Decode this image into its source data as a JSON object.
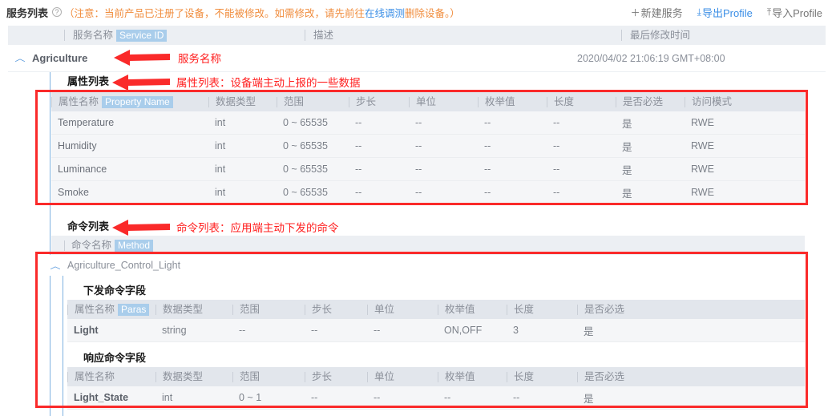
{
  "header": {
    "title": "服务列表",
    "help_icon": "help-circle-icon",
    "notice_prefix": "（注意：当前产品已注册了设备，不能被修改。如需修改，请先前往",
    "notice_link": "在线调测",
    "notice_suffix": "删除设备。）",
    "actions": [
      {
        "icon": "plus-icon",
        "glyph": "＋",
        "label": "新建服务",
        "style": "grey"
      },
      {
        "icon": "download-icon",
        "glyph": "⤓",
        "label": "导出Profile",
        "style": "blue"
      },
      {
        "icon": "upload-icon",
        "glyph": "⤒",
        "label": "导入Profile",
        "style": "grey"
      }
    ]
  },
  "service_table": {
    "columns": [
      {
        "label": "服务名称",
        "highlight": "Service ID"
      },
      {
        "label": "描述",
        "highlight": ""
      },
      {
        "label": "最后修改时间",
        "highlight": ""
      }
    ],
    "row": {
      "expander": "collapse-caret-icon",
      "name": "Agriculture",
      "description": "",
      "last_modified": "2020/04/02 21:06:19 GMT+08:00"
    }
  },
  "property_section": {
    "title": "属性列表",
    "annotation": "属性列表：设备端主动上报的一些数据",
    "arrow": "left-arrow-icon",
    "columns": [
      {
        "label": "属性名称",
        "highlight": "Property Name"
      },
      {
        "label": "数据类型",
        "highlight": ""
      },
      {
        "label": "范围",
        "highlight": ""
      },
      {
        "label": "步长",
        "highlight": ""
      },
      {
        "label": "单位",
        "highlight": ""
      },
      {
        "label": "枚举值",
        "highlight": ""
      },
      {
        "label": "长度",
        "highlight": ""
      },
      {
        "label": "是否必选",
        "highlight": ""
      },
      {
        "label": "访问模式",
        "highlight": ""
      }
    ],
    "rows": [
      {
        "name": "Temperature",
        "type": "int",
        "range": "0 ~ 65535",
        "step": "--",
        "unit": "--",
        "enum": "--",
        "length": "--",
        "required": "是",
        "access": "RWE"
      },
      {
        "name": "Humidity",
        "type": "int",
        "range": "0 ~ 65535",
        "step": "--",
        "unit": "--",
        "enum": "--",
        "length": "--",
        "required": "是",
        "access": "RWE"
      },
      {
        "name": "Luminance",
        "type": "int",
        "range": "0 ~ 65535",
        "step": "--",
        "unit": "--",
        "enum": "--",
        "length": "--",
        "required": "是",
        "access": "RWE"
      },
      {
        "name": "Smoke",
        "type": "int",
        "range": "0 ~ 65535",
        "step": "--",
        "unit": "--",
        "enum": "--",
        "length": "--",
        "required": "是",
        "access": "RWE"
      }
    ]
  },
  "command_section": {
    "title": "命令列表",
    "annotation": "命令列表：应用端主动下发的命令",
    "arrow": "left-arrow-icon",
    "columns": [
      {
        "label": "命令名称",
        "highlight": "Method"
      }
    ],
    "command": {
      "expander": "collapse-caret-icon",
      "name": "Agriculture_Control_Light",
      "request": {
        "title": "下发命令字段",
        "columns": [
          {
            "label": "属性名称",
            "highlight": "Paras"
          },
          {
            "label": "数据类型",
            "highlight": ""
          },
          {
            "label": "范围",
            "highlight": ""
          },
          {
            "label": "步长",
            "highlight": ""
          },
          {
            "label": "单位",
            "highlight": ""
          },
          {
            "label": "枚举值",
            "highlight": ""
          },
          {
            "label": "长度",
            "highlight": ""
          },
          {
            "label": "是否必选",
            "highlight": ""
          }
        ],
        "rows": [
          {
            "name": "Light",
            "type": "string",
            "range": "--",
            "step": "--",
            "unit": "--",
            "enum": "ON,OFF",
            "length": "3",
            "required": "是"
          }
        ]
      },
      "response": {
        "title": "响应命令字段",
        "columns": [
          {
            "label": "属性名称",
            "highlight": ""
          },
          {
            "label": "数据类型",
            "highlight": ""
          },
          {
            "label": "范围",
            "highlight": ""
          },
          {
            "label": "步长",
            "highlight": ""
          },
          {
            "label": "单位",
            "highlight": ""
          },
          {
            "label": "枚举值",
            "highlight": ""
          },
          {
            "label": "长度",
            "highlight": ""
          },
          {
            "label": "是否必选",
            "highlight": ""
          }
        ],
        "rows": [
          {
            "name": "Light_State",
            "type": "int",
            "range": "0 ~ 1",
            "step": "--",
            "unit": "--",
            "enum": "--",
            "length": "--",
            "required": "是"
          }
        ]
      }
    }
  },
  "annotations": {
    "service_name_label": "服务名称",
    "service_name_arrow": "left-arrow-icon"
  },
  "colors": {
    "highlight_blue": "#a9cdeb",
    "annotation_red": "#fa2a2a",
    "link_blue": "#3a8ee6",
    "notice_orange": "#f08c3c",
    "header_grey": "#e2e6ec",
    "row_grey": "#f5f6f8"
  }
}
